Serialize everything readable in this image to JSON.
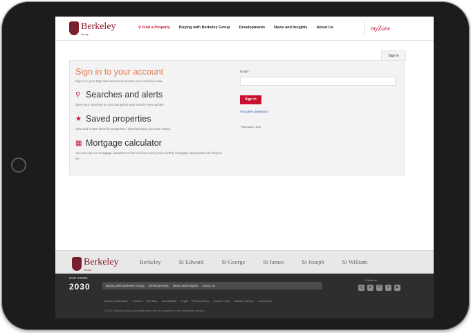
{
  "header": {
    "logo_name": "Berkeley",
    "logo_sub": "Group",
    "nav": [
      {
        "label": "Find a Property",
        "icon": "search-icon"
      },
      {
        "label": "Buying with Berkeley Group"
      },
      {
        "label": "Developments"
      },
      {
        "label": "News and Insights"
      },
      {
        "label": "About Us"
      }
    ],
    "myzone": "myZone"
  },
  "tab": {
    "label": "Sign in"
  },
  "panel": {
    "title": "Sign in to your account",
    "subtitle": "Sign in to your MyHome account to access your exclusive area.",
    "features": [
      {
        "icon": "search-icon",
        "title": "Searches and alerts",
        "desc": "Save your searches so you can get be your results even quicker."
      },
      {
        "icon": "star-icon",
        "title": "Saved properties",
        "desc": "View and create alerts for properties / developments you have saved."
      },
      {
        "icon": "calculator-icon",
        "title": "Mortgage calculator",
        "desc": "You can use our mortgage calculator to find out how much your monthly mortgage repayments are likely to be."
      }
    ]
  },
  "form": {
    "email_label": "Email *",
    "email_value": "",
    "signin_button": "Sign in",
    "forgot_link": "Forgotten password",
    "mandatory_note": "* Mandatory field"
  },
  "brands": {
    "footer_logo": "Berkeley",
    "footer_logo_sub": "Group",
    "items": [
      "Berkeley",
      "St Edward",
      "St George",
      "St James",
      "St Joseph",
      "St William"
    ]
  },
  "footer": {
    "vision_small": "OUR VISION",
    "vision_big": "2030",
    "nav": [
      "Buying with Berkeley Group",
      "Developments",
      "News and Insights",
      "About Us"
    ],
    "follow": "Follow us",
    "socials": [
      {
        "icon": "instagram-icon",
        "glyph": "◎"
      },
      {
        "icon": "linkedin-icon",
        "glyph": "in"
      },
      {
        "icon": "pinterest-icon",
        "glyph": "P"
      },
      {
        "icon": "twitter-icon",
        "glyph": "t"
      },
      {
        "icon": "youtube-icon",
        "glyph": "▶"
      }
    ],
    "legal": [
      "Investor Information",
      "Careers",
      "Site Map",
      "Accessibility",
      "Legal",
      "Privacy Policy",
      "Cookie Policy",
      "Modern Slavery",
      "Contact Us"
    ],
    "copyright": "© 2021 Berkeley Group. All trademarks are the property of their respective owners."
  }
}
